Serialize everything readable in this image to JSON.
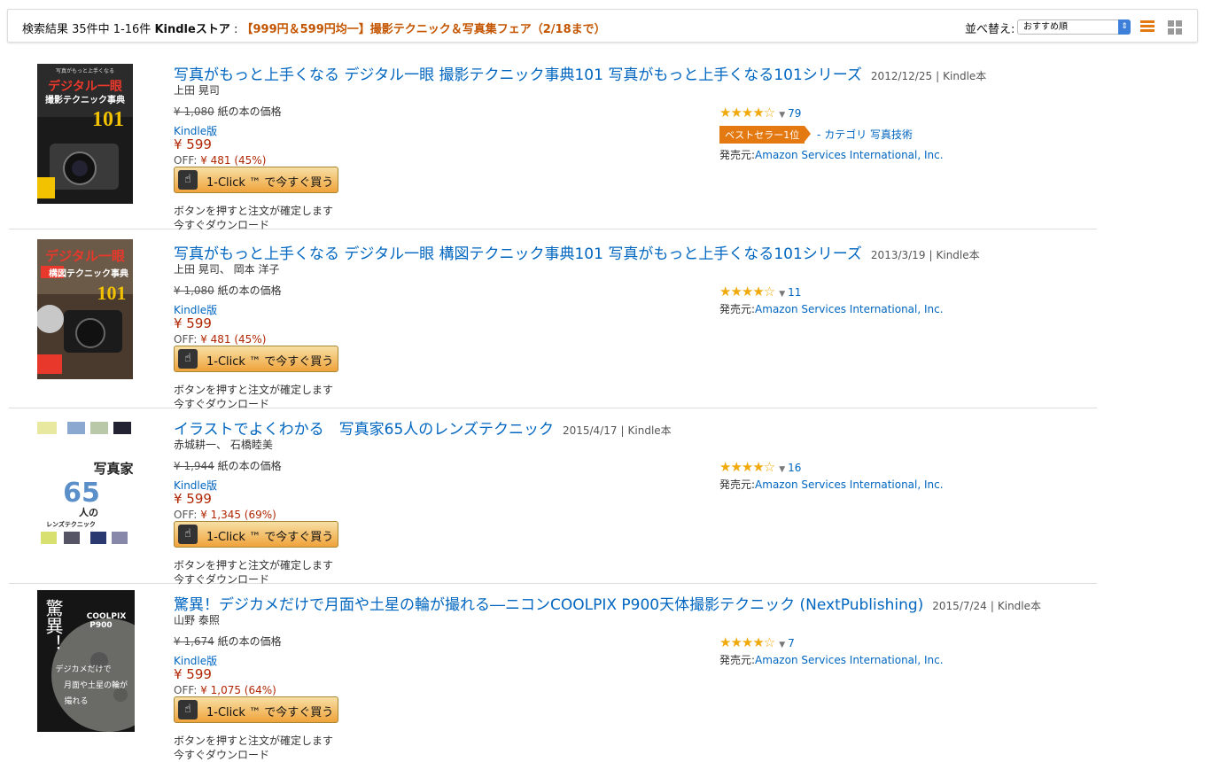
{
  "topbar": {
    "result_count": "検索結果 35件中 1-16件",
    "store": "Kindleストア",
    "separator": " : ",
    "fair": "【999円＆599円均一】撮影テクニック＆写真集フェア（2/18まで）",
    "sort_label": "並べ替え:",
    "sort_value": "おすすめ順"
  },
  "common": {
    "paper_label": "紙の本の価格",
    "kindle_label": "Kindle版",
    "off_label": "OFF: ",
    "oneclick_label": "1-Click ™ で今すぐ買う",
    "confirm_line1": "ボタンを押すと注文が確定します",
    "confirm_line2": "今すぐダウンロード",
    "seller_label": "発売元:",
    "seller_name": "Amazon Services International, Inc.",
    "format": "Kindle本"
  },
  "results": [
    {
      "title": "写真がもっと上手くなる デジタル一眼 撮影テクニック事典101 写真がもっと上手くなる101シリーズ",
      "date": "2012/12/25",
      "authors": "上田 晃司",
      "paper_price": "¥ 1,080",
      "price": "¥ 599",
      "off": "¥ 481 (45%)",
      "stars": "★★★★☆",
      "star_value": 4.5,
      "review_count": "79",
      "bestseller": "ベストセラー1位",
      "bestseller_category_prefix": "- カテゴリ",
      "bestseller_category": "写真技術",
      "cover_text": [
        "写真がもっと上手くなる",
        "デジタル一眼",
        "撮影テクニック事典",
        "101"
      ]
    },
    {
      "title": "写真がもっと上手くなる デジタル一眼 構図テクニック事典101 写真がもっと上手くなる101シリーズ",
      "date": "2013/3/19",
      "authors": "上田 晃司、 岡本 洋子",
      "paper_price": "¥ 1,080",
      "price": "¥ 599",
      "off": "¥ 481 (45%)",
      "stars": "★★★★☆",
      "star_value": 4.5,
      "review_count": "11",
      "cover_text": [
        "デジタル一眼",
        "構図テクニック事典",
        "101"
      ]
    },
    {
      "title": "イラストでよくわかる　写真家65人のレンズテクニック",
      "date": "2015/4/17",
      "authors": "赤城耕一、 石橋睦美",
      "paper_price": "¥ 1,944",
      "price": "¥ 599",
      "off": "¥ 1,345 (69%)",
      "stars": "★★★★☆",
      "star_value": 4,
      "review_count": "16",
      "cover_text": [
        "写真家",
        "65",
        "人の",
        "レンズテクニック"
      ]
    },
    {
      "title": "驚異！デジカメだけで月面や土星の輪が撮れる―ニコンCOOLPIX P900天体撮影テクニック (NextPublishing)",
      "date": "2015/7/24",
      "authors": "山野 泰照",
      "paper_price": "¥ 1,674",
      "price": "¥ 599",
      "off": "¥ 1,075 (64%)",
      "stars": "★★★★☆",
      "star_value": 4,
      "review_count": "7",
      "cover_text": [
        "驚異！",
        "COOLPIX",
        "P900",
        "デジカメだけで",
        "月面や土星の輪が",
        "撮れる"
      ]
    }
  ],
  "colors": {
    "link": "#0066c0",
    "price": "#b12704",
    "accent": "#e47911",
    "star": "#f0a90a"
  }
}
